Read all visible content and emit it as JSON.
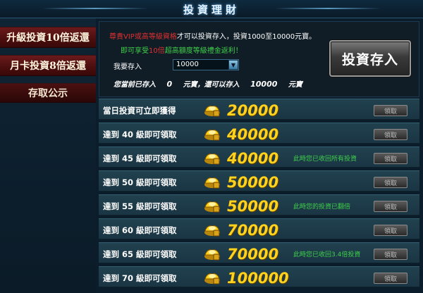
{
  "title": "投資理財",
  "sidebar": {
    "items": [
      {
        "label": "升級投資10倍返還"
      },
      {
        "label": "月卡投資8倍返還"
      },
      {
        "label": "存取公示"
      }
    ]
  },
  "info": {
    "line1_red": "尊貴VIP或高等級資格",
    "line1_white": "才可以投資存入，投資1000至10000元寶。",
    "line2_green": "即可享受",
    "line2_red": "10倍",
    "line2_green2": "超高額度等級禮金返利！"
  },
  "deposit": {
    "label": "我要存入",
    "selected": "10000"
  },
  "summary": {
    "prefix": "您當前已存入",
    "deposited": "0",
    "middle": "元寶，還可以存入",
    "remaining": "10000",
    "suffix": "元寶"
  },
  "invest_button": "投資存入",
  "claim_label": "領取",
  "rows": [
    {
      "condition": "當日投資可立即獲得",
      "amount": "20000",
      "note": ""
    },
    {
      "condition": "達到 40 級即可領取",
      "amount": "40000",
      "note": ""
    },
    {
      "condition": "達到 45 級即可領取",
      "amount": "40000",
      "note": "此時您已收回所有投資"
    },
    {
      "condition": "達到 50 級即可領取",
      "amount": "50000",
      "note": ""
    },
    {
      "condition": "達到 55 級即可領取",
      "amount": "50000",
      "note": "此時您的投資已翻倍"
    },
    {
      "condition": "達到 60 級即可領取",
      "amount": "70000",
      "note": ""
    },
    {
      "condition": "達到 65 級即可領取",
      "amount": "70000",
      "note": "此時您已收回3.4倍投資"
    },
    {
      "condition": "達到 70 級即可領取",
      "amount": "100000",
      "note": ""
    }
  ],
  "colors": {
    "gold": "#ffd21e",
    "note_green": "#3ed04a",
    "warn_red": "#e03030"
  }
}
